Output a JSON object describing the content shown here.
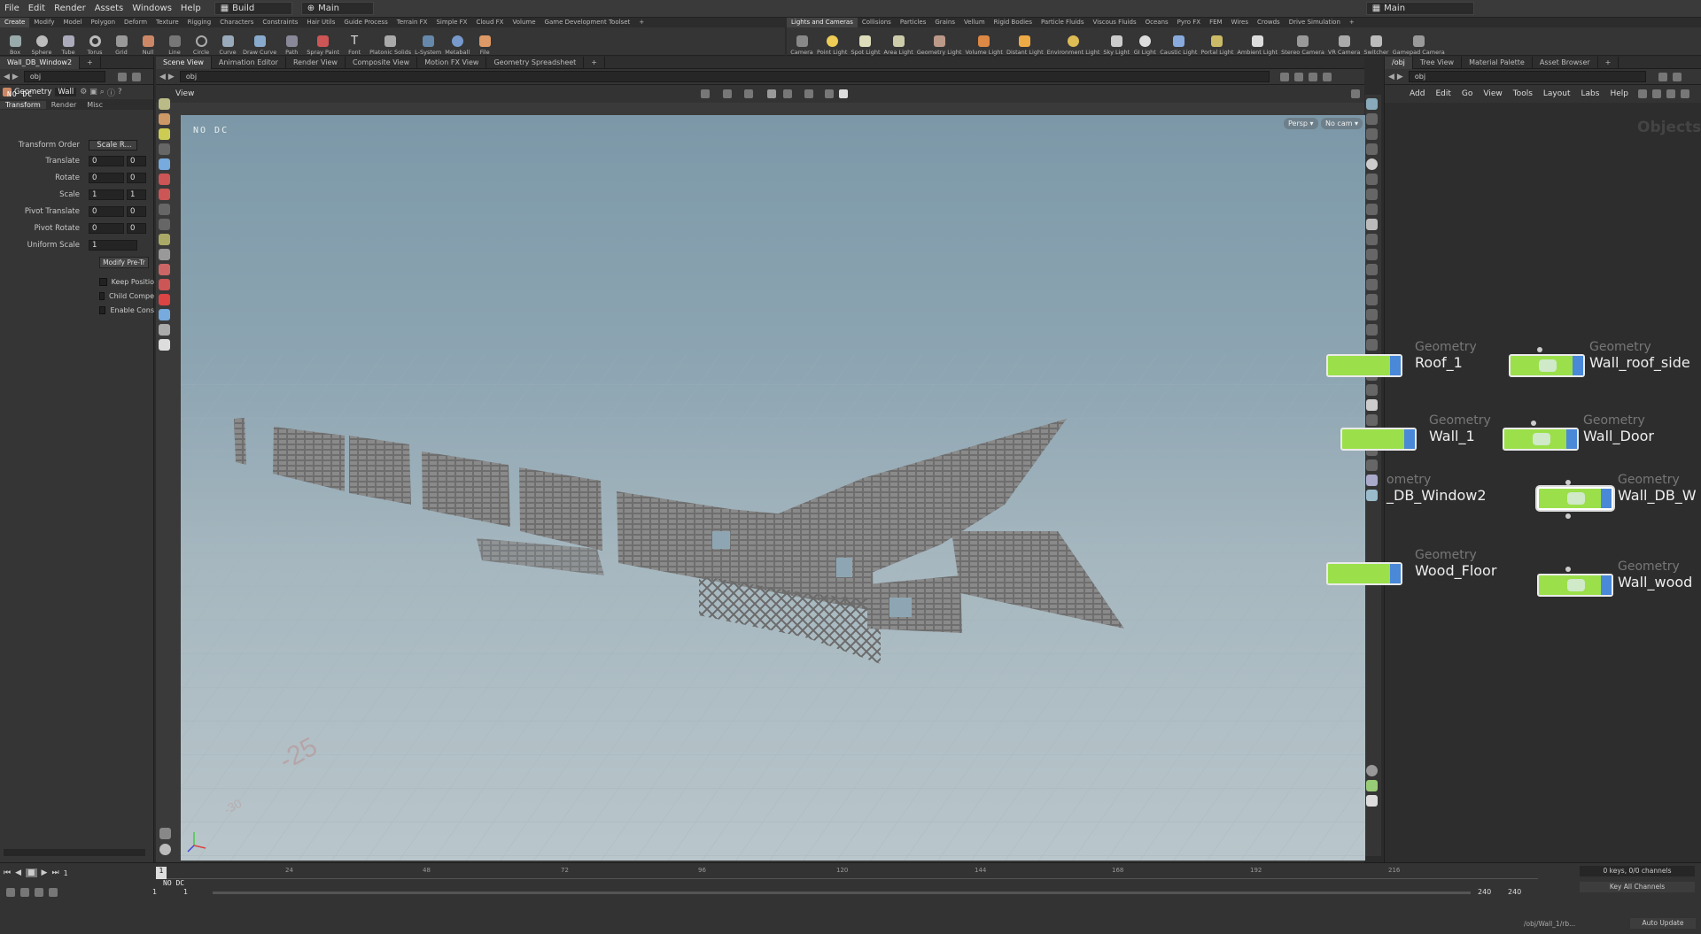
{
  "menubar": {
    "items": [
      "File",
      "Edit",
      "Render",
      "Assets",
      "Windows",
      "Help"
    ],
    "desktop": "Build",
    "context": "Main",
    "right_context": "Main"
  },
  "shelf_left": {
    "tabs": [
      "Create",
      "Modify",
      "Model",
      "Polygon",
      "Deform",
      "Texture",
      "Rigging",
      "Characters",
      "Constraints",
      "Hair Utils",
      "Guide Process",
      "Terrain FX",
      "Simple FX",
      "Cloud FX",
      "Volume",
      "Game Development Toolset"
    ],
    "tools": [
      "Box",
      "Sphere",
      "Tube",
      "Torus",
      "Grid",
      "Null",
      "Line",
      "Circle",
      "Curve",
      "Draw Curve",
      "Path",
      "Spray Paint",
      "Font",
      "Platonic Solids",
      "L-System",
      "Metaball",
      "File"
    ]
  },
  "shelf_right": {
    "tabs": [
      "Lights and Cameras",
      "Collisions",
      "Particles",
      "Grains",
      "Vellum",
      "Rigid Bodies",
      "Particle Fluids",
      "Viscous Fluids",
      "Oceans",
      "Pyro FX",
      "FEM",
      "Wires",
      "Crowds",
      "Drive Simulation"
    ],
    "tools": [
      "Camera",
      "Point Light",
      "Spot Light",
      "Area Light",
      "Geometry Light",
      "Volume Light",
      "Distant Light",
      "Environment Light",
      "Sky Light",
      "GI Light",
      "Caustic Light",
      "Portal Light",
      "Ambient Light",
      "Stereo Camera",
      "VR Camera",
      "Switcher",
      "Gamepad Camera"
    ]
  },
  "param_pane": {
    "tab": "Wall_DB_Window2",
    "path": "obj",
    "node_type": "Geometry",
    "node_name": "Wall",
    "overlay": "NO DC",
    "subtabs": [
      "Transform",
      "Render",
      "Misc"
    ],
    "params": [
      {
        "label": "Transform Order",
        "v1": "Scale R...",
        "v2": ""
      },
      {
        "label": "Translate",
        "v1": "0",
        "v2": "0"
      },
      {
        "label": "Rotate",
        "v1": "0",
        "v2": "0"
      },
      {
        "label": "Scale",
        "v1": "1",
        "v2": "1"
      },
      {
        "label": "Pivot Translate",
        "v1": "0",
        "v2": "0"
      },
      {
        "label": "Pivot Rotate",
        "v1": "0",
        "v2": "0"
      },
      {
        "label": "Uniform Scale",
        "v1": "1",
        "v2": ""
      }
    ],
    "modify_button": "Modify Pre-Tr",
    "checks": [
      "Keep Positio",
      "Child Compe",
      "Enable Cons"
    ]
  },
  "viewport": {
    "tabs": [
      "Scene View",
      "Animation Editor",
      "Render View",
      "Composite View",
      "Motion FX View",
      "Geometry Spreadsheet"
    ],
    "path": "obj",
    "title": "View",
    "overlay": "NO DC",
    "persp": "Persp",
    "cam": "No cam",
    "grid_label": "-25",
    "grid_label2": "-30"
  },
  "network": {
    "tabs": [
      "/obj",
      "Tree View",
      "Material Palette",
      "Asset Browser"
    ],
    "path": "obj",
    "menu": [
      "Add",
      "Edit",
      "Go",
      "View",
      "Tools",
      "Layout",
      "Labs",
      "Help"
    ],
    "watermark": "Objects",
    "nodes": [
      {
        "cat": "Geometry",
        "name": "Roof_1"
      },
      {
        "cat": "Geometry",
        "name": "Wall_roof_side"
      },
      {
        "cat": "Geometry",
        "name": "Wall_1"
      },
      {
        "cat": "Geometry",
        "name": "Wall_Door"
      },
      {
        "cat": "ometry",
        "name": "_DB_Window2"
      },
      {
        "cat": "Geometry",
        "name": "Wall_DB_W"
      },
      {
        "cat": "Geometry",
        "name": "Wood_Floor"
      },
      {
        "cat": "Geometry",
        "name": "Wall_wood"
      }
    ]
  },
  "timeline": {
    "frame": "1",
    "start": "1",
    "start2": "1",
    "end": "240",
    "end2": "240",
    "ticks": [
      "24",
      "48",
      "72",
      "96",
      "120",
      "144",
      "168",
      "192",
      "216"
    ],
    "overlay": "NO DC",
    "keys": "0 keys, 0/0 channels",
    "key_all": "Key All Channels",
    "status_path": "/obj/Wall_1/rb...",
    "auto_update": "Auto Update"
  }
}
